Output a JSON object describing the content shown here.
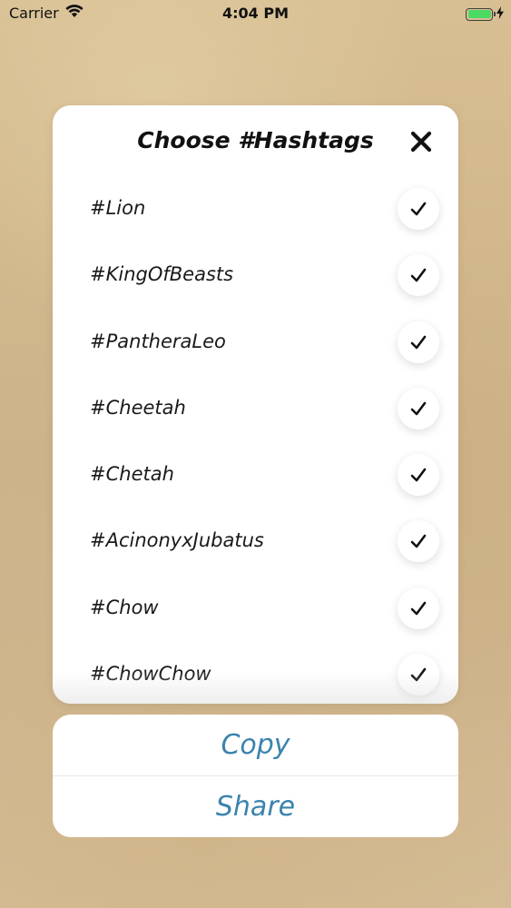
{
  "status_bar": {
    "carrier": "Carrier",
    "time": "4:04 PM",
    "battery_level": 1.0,
    "battery_color": "#4cd964",
    "icons": [
      "wifi-icon",
      "battery-icon",
      "charging-bolt-icon"
    ]
  },
  "sheet": {
    "title": "Choose #Hashtags",
    "close_icon": "close-icon",
    "hashtags": [
      {
        "label": "#Lion",
        "checked": true
      },
      {
        "label": "#KingOfBeasts",
        "checked": true
      },
      {
        "label": "#PantheraLeo",
        "checked": true
      },
      {
        "label": "#Cheetah",
        "checked": true
      },
      {
        "label": "#Chetah",
        "checked": true
      },
      {
        "label": "#AcinonyxJubatus",
        "checked": true
      },
      {
        "label": "#Chow",
        "checked": true
      },
      {
        "label": "#ChowChow",
        "checked": true
      }
    ]
  },
  "actions": {
    "copy_label": "Copy",
    "share_label": "Share",
    "accent_color": "#3a83ac"
  }
}
